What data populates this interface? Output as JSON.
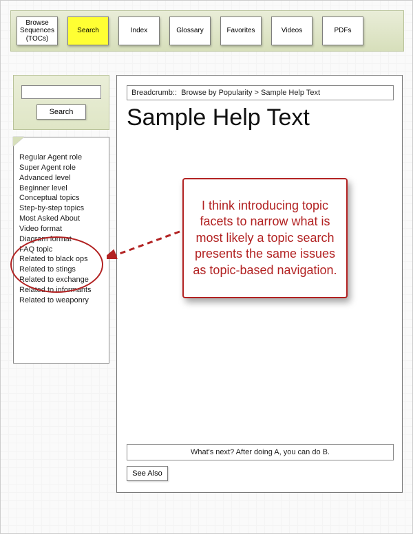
{
  "top_tabs": [
    {
      "label": "Browse Sequences (TOCs)",
      "active": false
    },
    {
      "label": "Search",
      "active": true
    },
    {
      "label": "Index",
      "active": false
    },
    {
      "label": "Glossary",
      "active": false
    },
    {
      "label": "Favorites",
      "active": false
    },
    {
      "label": "Videos",
      "active": false
    },
    {
      "label": "PDFs",
      "active": false
    }
  ],
  "search": {
    "input_value": "",
    "placeholder": "",
    "button_label": "Search"
  },
  "facets": [
    "Regular Agent role",
    "Super Agent role",
    "Advanced level",
    "Beginner level",
    "Conceptual topics",
    "Step-by-step topics",
    "Most Asked About",
    "Video format",
    "Diagram format",
    "FAQ topic",
    "Related to black ops",
    "Related to stings",
    "Related to exchange",
    "Related to informants",
    "Related to weaponry"
  ],
  "main": {
    "breadcrumb_prefix": "Breadcrumb::",
    "breadcrumb_path": "Browse by Popularity > Sample Help Text",
    "title": "Sample Help Text",
    "whats_next": "What's next? After doing A, you can do B.",
    "see_also_label": "See Also"
  },
  "annotation": {
    "text": "I think introducing topic facets to narrow what is most likely a topic search presents the same issues as topic-based navigation.",
    "color": "#B22222"
  }
}
